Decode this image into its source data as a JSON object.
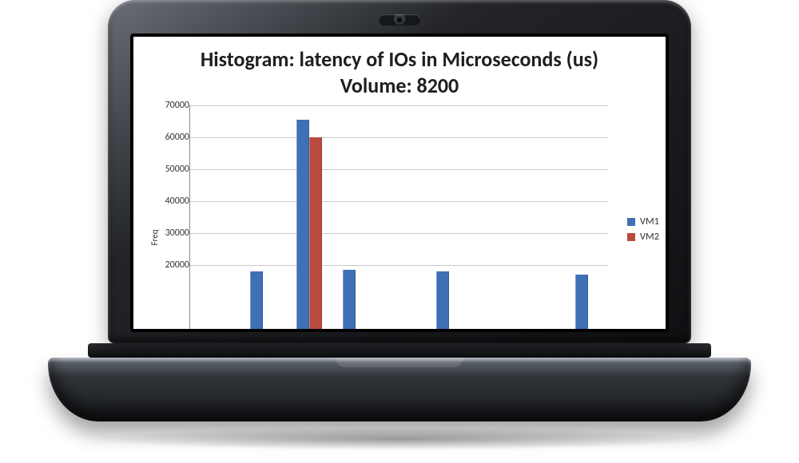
{
  "chart_data": {
    "type": "bar",
    "title": "Histogram: latency of IOs in Microseconds (us)",
    "subtitle": "Volume: 8200",
    "ylabel": "Freq",
    "ylim": [
      0,
      70000
    ],
    "yticks": [
      20000,
      30000,
      40000,
      50000,
      60000,
      70000
    ],
    "series": [
      {
        "name": "VM1",
        "values": [
          0,
          18000,
          65500,
          18500,
          0,
          18000,
          0,
          0,
          17000
        ]
      },
      {
        "name": "VM2",
        "values": [
          0,
          0,
          60000,
          0,
          0,
          0,
          0,
          0,
          0
        ]
      }
    ],
    "categories_note": "x-axis bucket labels not visible in viewport"
  },
  "legend": [
    "VM1",
    "VM2"
  ]
}
